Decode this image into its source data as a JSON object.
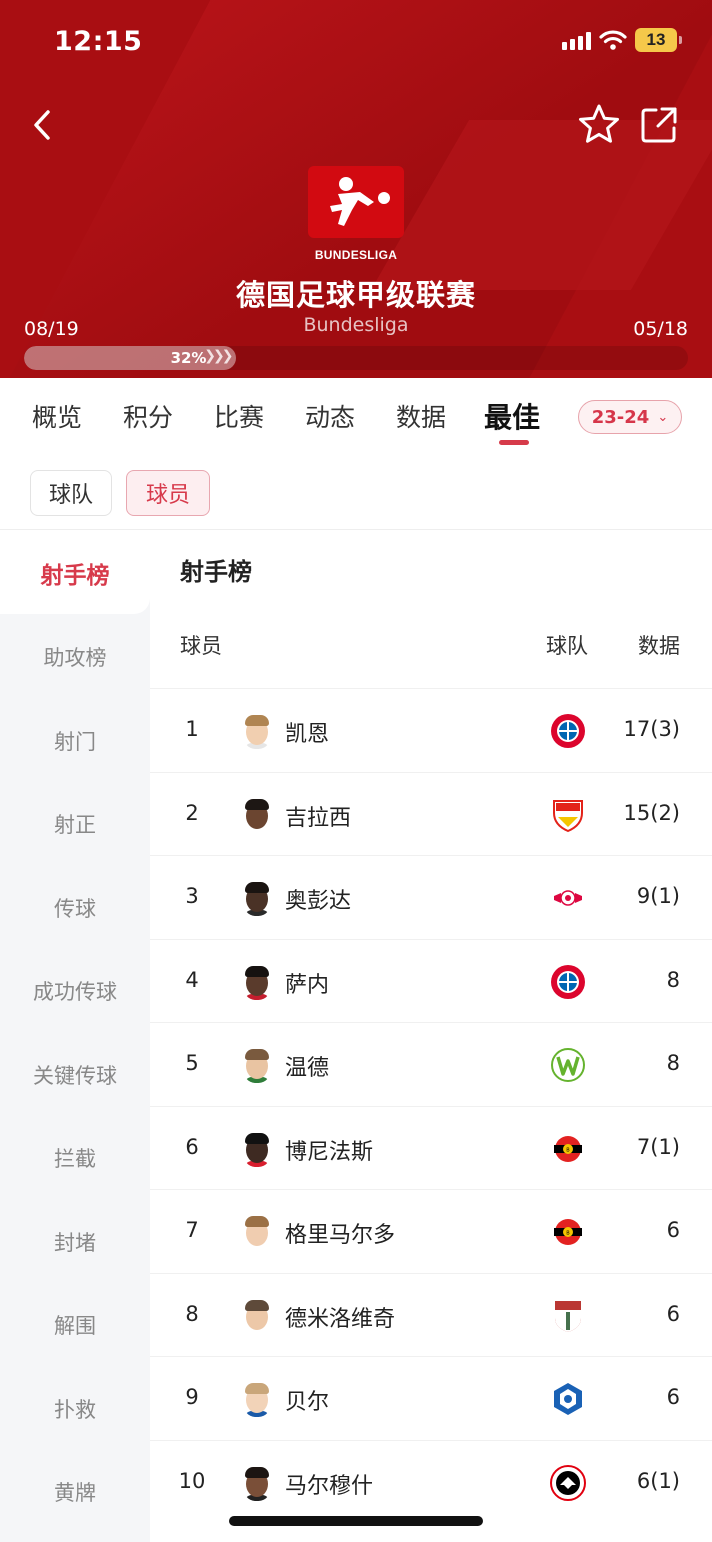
{
  "status_bar": {
    "time": "12:15",
    "battery": "13"
  },
  "league": {
    "logo_text": "BUNDESLIGA",
    "title": "德国足球甲级联赛",
    "subtitle": "Bundesliga",
    "season_start": "08/19",
    "season_end": "05/18",
    "progress_label": "32%",
    "progress_value": 0.32
  },
  "tabs": [
    "概览",
    "积分",
    "比赛",
    "动态",
    "数据",
    "最佳"
  ],
  "active_tab": "最佳",
  "season_selector": "23-24",
  "type_chips": {
    "team": "球队",
    "player": "球员"
  },
  "sidebar": [
    "射手榜",
    "助攻榜",
    "射门",
    "射正",
    "传球",
    "成功传球",
    "关键传球",
    "拦截",
    "封堵",
    "解围",
    "扑救",
    "黄牌"
  ],
  "list": {
    "title": "射手榜",
    "col_player": "球员",
    "col_team": "球队",
    "col_data": "数据",
    "rows": [
      {
        "rank": "1",
        "name": "凯恩",
        "stat": "17(3)",
        "team_icon": "bayern-crest-icon"
      },
      {
        "rank": "2",
        "name": "吉拉西",
        "stat": "15(2)",
        "team_icon": "stuttgart-crest-icon"
      },
      {
        "rank": "3",
        "name": "奥彭达",
        "stat": "9(1)",
        "team_icon": "leipzig-crest-icon"
      },
      {
        "rank": "4",
        "name": "萨内",
        "stat": "8",
        "team_icon": "bayern-crest-icon"
      },
      {
        "rank": "5",
        "name": "温德",
        "stat": "8",
        "team_icon": "wolfsburg-crest-icon"
      },
      {
        "rank": "6",
        "name": "博尼法斯",
        "stat": "7(1)",
        "team_icon": "leverkusen-crest-icon"
      },
      {
        "rank": "7",
        "name": "格里马尔多",
        "stat": "6",
        "team_icon": "leverkusen-crest-icon"
      },
      {
        "rank": "8",
        "name": "德米洛维奇",
        "stat": "6",
        "team_icon": "augsburg-crest-icon"
      },
      {
        "rank": "9",
        "name": "贝尔",
        "stat": "6",
        "team_icon": "hoffenheim-crest-icon"
      },
      {
        "rank": "10",
        "name": "马尔穆什",
        "stat": "6(1)",
        "team_icon": "frankfurt-crest-icon"
      }
    ]
  },
  "colors": {
    "header_red": "#a90e12",
    "accent": "#d73a4b",
    "sidebar_bg": "#f5f6f8"
  }
}
